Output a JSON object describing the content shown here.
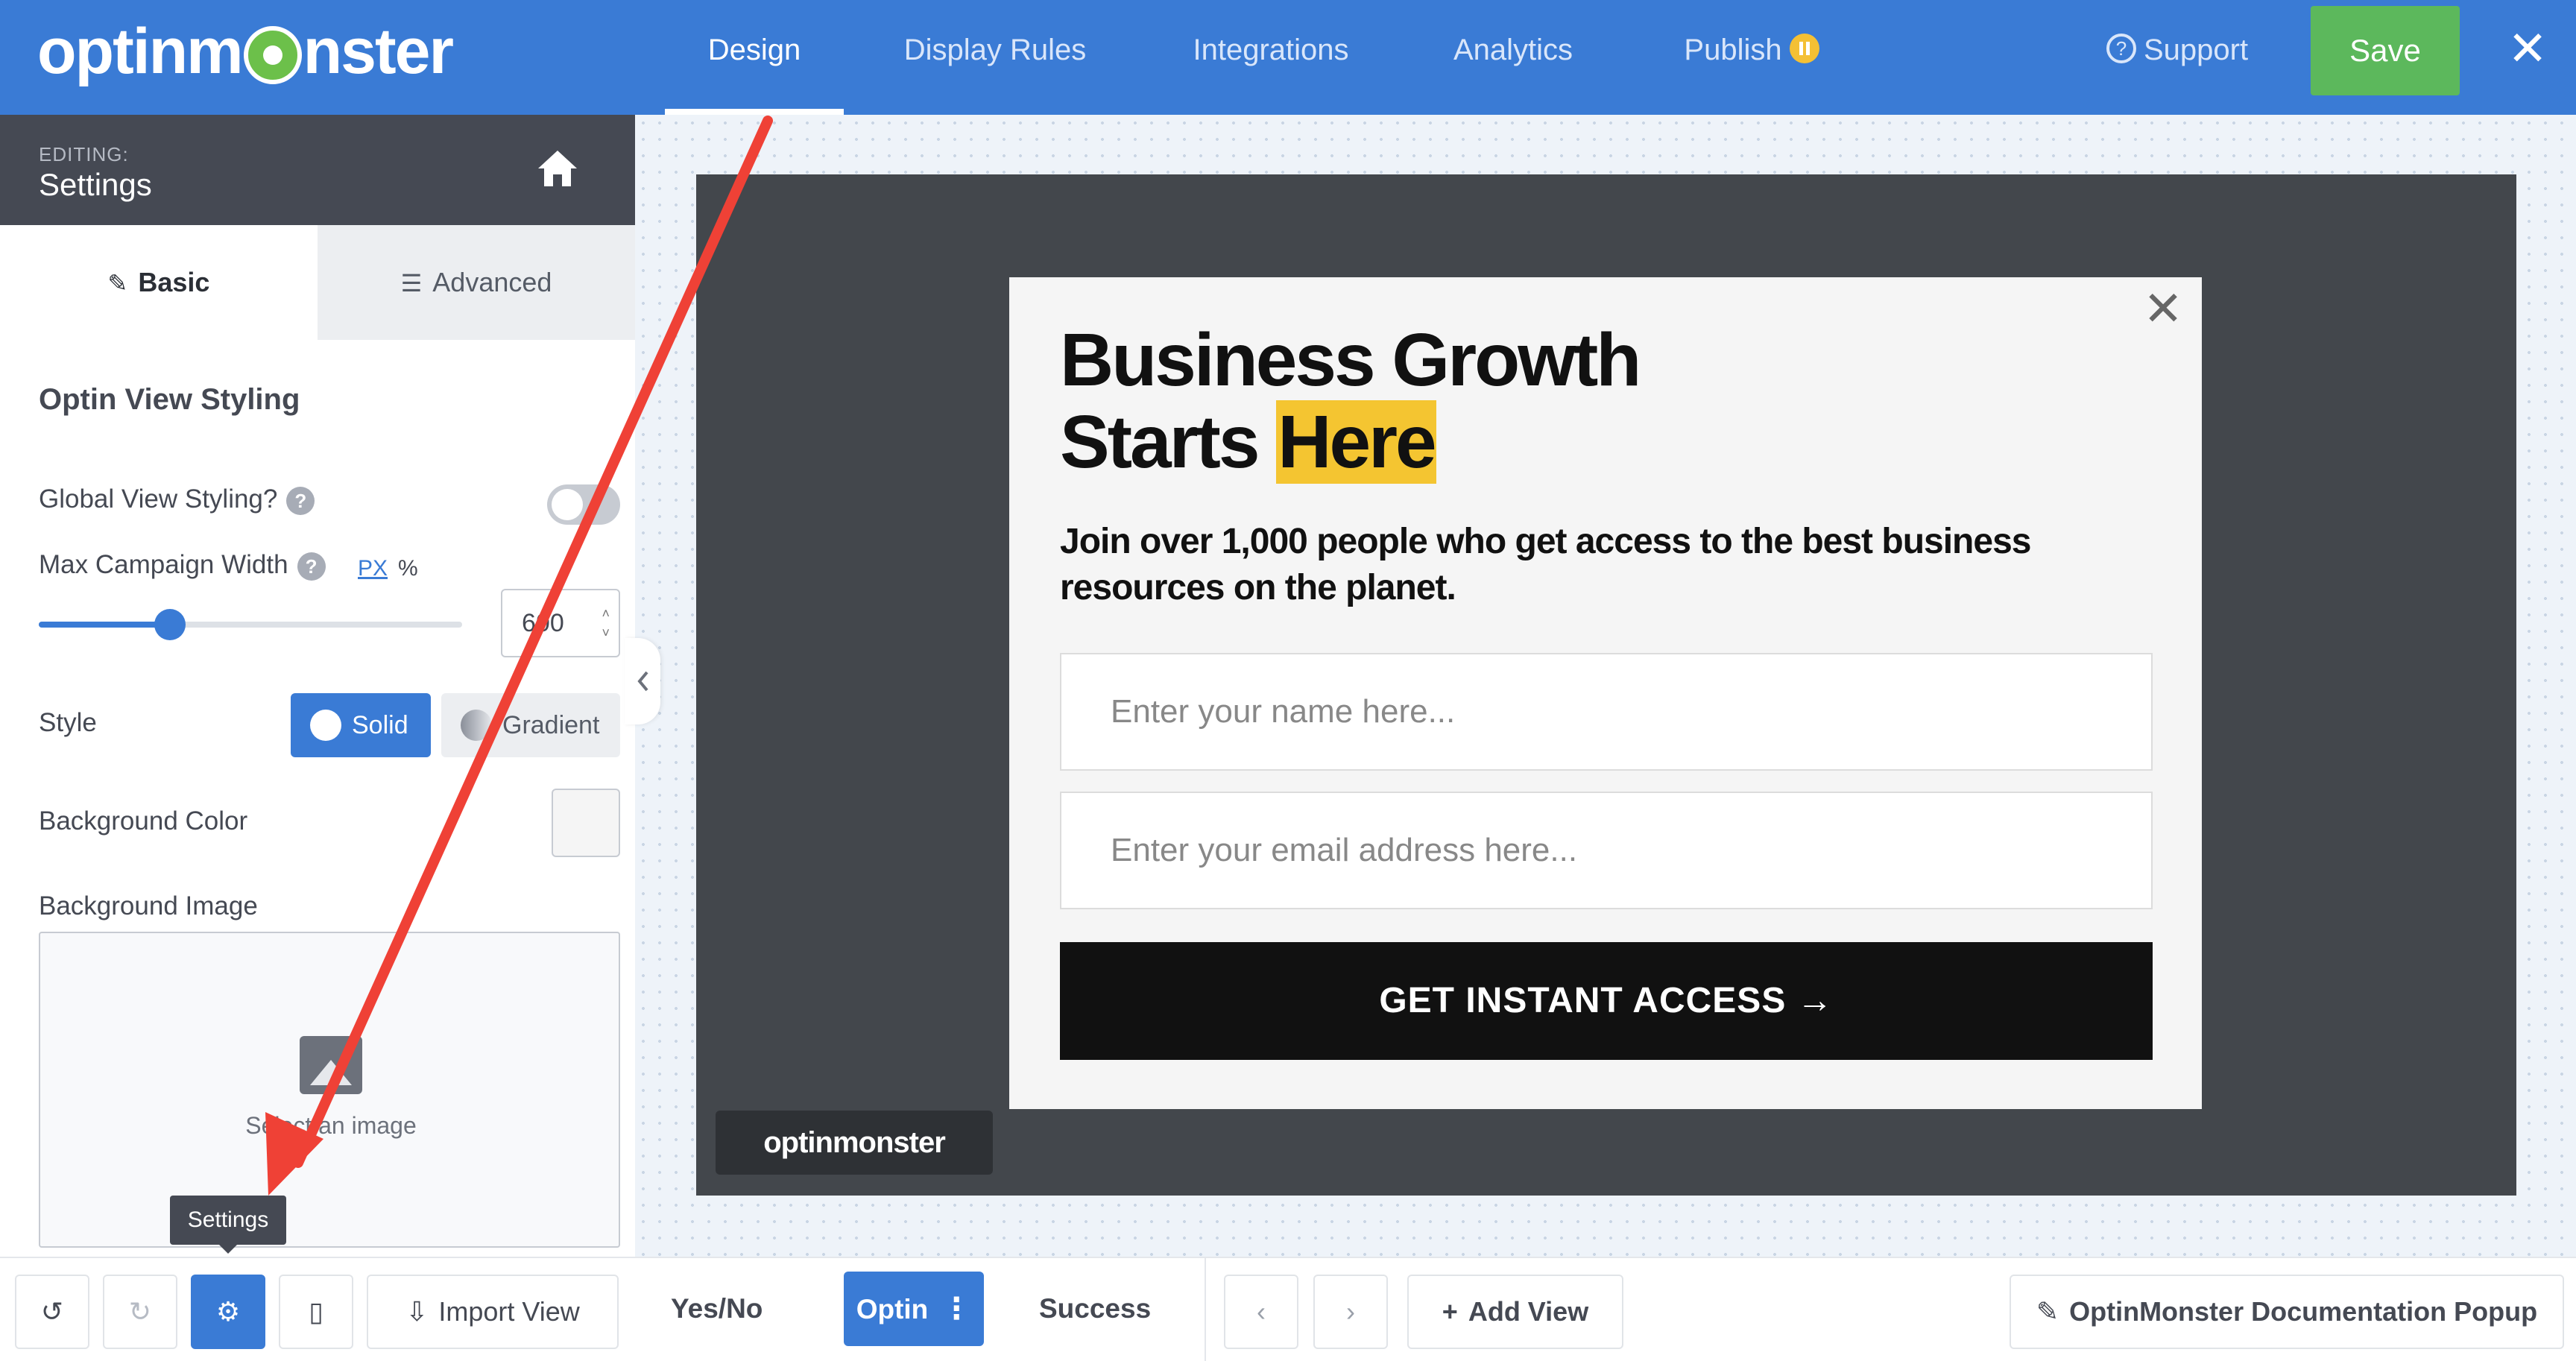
{
  "app": {
    "logo_text_left": "optinm",
    "logo_text_right": "nster",
    "brand_color": "#3a7bd5",
    "save_color": "#5cb85c"
  },
  "nav": {
    "tabs": [
      {
        "label": "Design",
        "active": true
      },
      {
        "label": "Display Rules",
        "active": false
      },
      {
        "label": "Integrations",
        "active": false
      },
      {
        "label": "Analytics",
        "active": false
      },
      {
        "label": "Publish",
        "active": false,
        "status_icon": "pause-icon"
      }
    ],
    "support_label": "Support",
    "save_label": "Save",
    "close_glyph": "✕"
  },
  "sidebar": {
    "editing_label": "EDITING:",
    "editing_title": "Settings",
    "tabs": {
      "basic": "Basic",
      "advanced": "Advanced"
    },
    "section_title": "Optin View Styling",
    "global_view_styling": {
      "label": "Global View Styling?",
      "enabled": false
    },
    "max_width": {
      "label": "Max Campaign Width",
      "unit_px": "PX",
      "unit_pct": "%",
      "value": "600",
      "slider_fraction": 0.31
    },
    "style": {
      "label": "Style",
      "solid": "Solid",
      "gradient": "Gradient",
      "selected": "Solid"
    },
    "background_color": {
      "label": "Background Color",
      "value": "#f5f5f5"
    },
    "background_image": {
      "label": "Background Image",
      "placeholder": "Select an image"
    }
  },
  "toolbar": {
    "import_view": "Import View",
    "tooltip": "Settings"
  },
  "popup": {
    "headline_line1": "Business Growth",
    "headline_line2_a": "Starts ",
    "headline_line2_b": "Here",
    "subhead": "Join over 1,000 people who get access to the best business resources on the planet.",
    "name_placeholder": "Enter your name here...",
    "email_placeholder": "Enter your email address here...",
    "cta": "GET INSTANT ACCESS →",
    "close_glyph": "✕",
    "highlight_color": "#f4c531",
    "badge_text": "optinmonster"
  },
  "views": {
    "items": [
      {
        "label": "Yes/No",
        "active": false
      },
      {
        "label": "Optin",
        "active": true
      },
      {
        "label": "Success",
        "active": false
      }
    ],
    "add_view": "Add View",
    "campaign_name": "OptinMonster Documentation Popup"
  }
}
